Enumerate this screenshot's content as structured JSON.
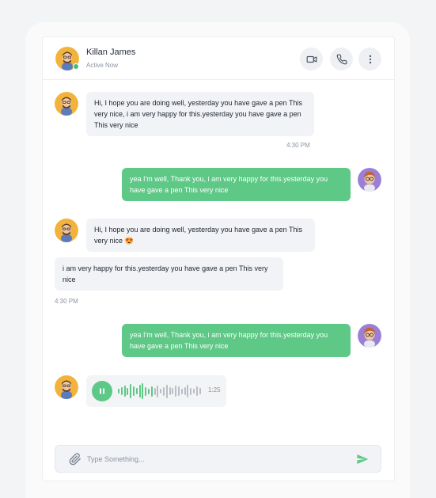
{
  "contact": {
    "name": "Killan James",
    "status": "Active Now"
  },
  "colors": {
    "accent": "#5ec886",
    "incoming_bg": "#f1f3f6",
    "online": "#3fc17a"
  },
  "header_actions": [
    "video-call-icon",
    "phone-call-icon",
    "more-options-icon"
  ],
  "messages": {
    "m1": {
      "text": "Hi, I hope you are doing well, yesterday you have gave a pen This very nice, i am very happy for this.yesterday you have gave a pen This very nice",
      "time": "4:30 PM"
    },
    "m2": {
      "text": "yea I'm well, Thank you, i am very happy for this.yesterday you have gave a pen This very nice"
    },
    "m3": {
      "text": "Hi, I hope you are doing well, yesterday you have gave a pen This very nice 😍"
    },
    "m4": {
      "text": "i am very happy for this.yesterday you have gave a pen This very nice",
      "time": "4:30 PM"
    },
    "m5": {
      "text": "yea I'm well, Thank you, i am very happy for this.yesterday you have gave a pen This very nice"
    },
    "voice": {
      "duration": "1:25",
      "state_icon": "pause-icon"
    }
  },
  "composer": {
    "placeholder": "Type Something...",
    "value": ""
  }
}
